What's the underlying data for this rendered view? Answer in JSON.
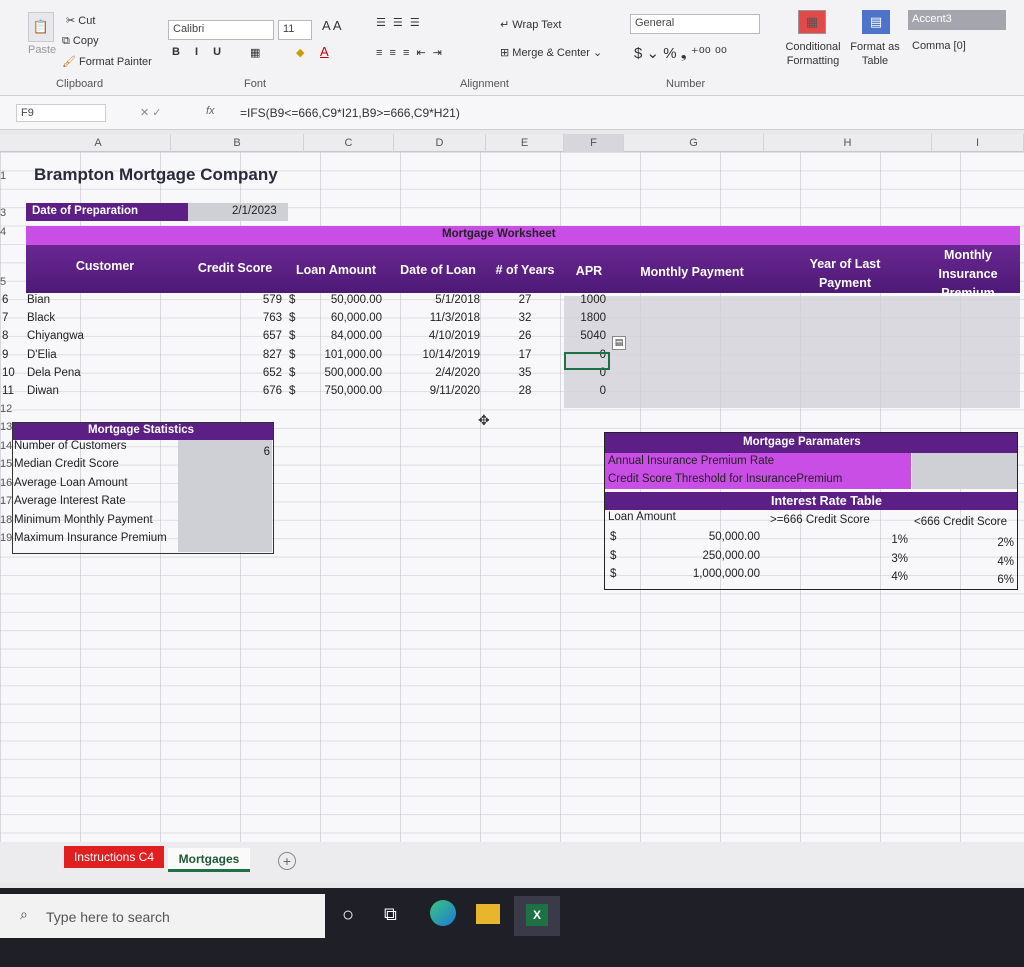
{
  "ribbon": {
    "clipboard": {
      "cut": "Cut",
      "copy": "Copy",
      "format_painter": "Format Painter",
      "paste": "Paste",
      "label": "Clipboard"
    },
    "font": {
      "name": "Calibri",
      "size": "11",
      "label": "Font"
    },
    "alignment": {
      "wrap_text": "Wrap Text",
      "merge_center": "Merge & Center",
      "label": "Alignment"
    },
    "number": {
      "format": "General",
      "label": "Number"
    },
    "styles": {
      "conditional_formatting": "Conditional Formatting",
      "format_as_table": "Format as Table",
      "accent3": "Accent3",
      "comma0": "Comma [0]"
    }
  },
  "formula_bar": {
    "name_box": "F9",
    "fx": "fx",
    "formula": "=IFS(B9<=666,C9*I21,B9>=666,C9*H21)"
  },
  "columns": [
    "A",
    "B",
    "C",
    "D",
    "E",
    "F",
    "G",
    "H",
    "I"
  ],
  "sheet": {
    "title": "Brampton Mortgage Company",
    "date_label": "Date of Preparation",
    "date_value": "2/1/2023",
    "worksheet_title": "Mortgage Worksheet",
    "headers": [
      "Customer",
      "Credit Score",
      "Loan Amount",
      "Date of Loan",
      "# of Years",
      "APR",
      "Monthly Payment",
      "Year of Last Payment",
      "Monthly Insurance Premium"
    ],
    "rows": [
      {
        "num": "6",
        "customer": "Bian",
        "score": "579",
        "cur": "$",
        "amount": "50,000.00",
        "date": "5/1/2018",
        "years": "27",
        "apr": "1000"
      },
      {
        "num": "7",
        "customer": "Black",
        "score": "763",
        "cur": "$",
        "amount": "60,000.00",
        "date": "11/3/2018",
        "years": "32",
        "apr": "1800"
      },
      {
        "num": "8",
        "customer": "Chiyangwa",
        "score": "657",
        "cur": "$",
        "amount": "84,000.00",
        "date": "4/10/2019",
        "years": "26",
        "apr": "5040"
      },
      {
        "num": "9",
        "customer": "D'Elia",
        "score": "827",
        "cur": "$",
        "amount": "101,000.00",
        "date": "10/14/2019",
        "years": "17",
        "apr": "0"
      },
      {
        "num": "10",
        "customer": "Dela Pena",
        "score": "652",
        "cur": "$",
        "amount": "500,000.00",
        "date": "2/4/2020",
        "years": "35",
        "apr": "0"
      },
      {
        "num": "11",
        "customer": "Diwan",
        "score": "676",
        "cur": "$",
        "amount": "750,000.00",
        "date": "9/11/2020",
        "years": "28",
        "apr": "0"
      }
    ],
    "stats": {
      "title": "Mortgage Statistics",
      "items": [
        {
          "num": "14",
          "label": "Number of Customers",
          "value": "6"
        },
        {
          "num": "15",
          "label": "Median Credit Score",
          "value": ""
        },
        {
          "num": "16",
          "label": "Average Loan Amount",
          "value": ""
        },
        {
          "num": "17",
          "label": "Average Interest Rate",
          "value": ""
        },
        {
          "num": "18",
          "label": "Minimum Monthly Payment",
          "value": ""
        },
        {
          "num": "19",
          "label": "Maximum Insurance Premium",
          "value": ""
        }
      ]
    },
    "params": {
      "title": "Mortgage Paramaters",
      "annual_rate": "Annual Insurance Premium Rate",
      "threshold": "Credit Score Threshold for InsurancePremium",
      "rate_table_title": "Interest Rate Table",
      "col_loan": "Loan Amount",
      "col_ge": ">=666 Credit Score",
      "col_lt": "<666 Credit Score",
      "rows": [
        {
          "cur": "$",
          "amount": "50,000.00",
          "ge": "1%",
          "lt": "2%"
        },
        {
          "cur": "$",
          "amount": "250,000.00",
          "ge": "3%",
          "lt": "4%"
        },
        {
          "cur": "$",
          "amount": "1,000,000.00",
          "ge": "4%",
          "lt": "6%"
        }
      ]
    }
  },
  "tabs": [
    "Instructions C4",
    "Mortgages"
  ],
  "taskbar": {
    "search_placeholder": "Type here to search"
  }
}
